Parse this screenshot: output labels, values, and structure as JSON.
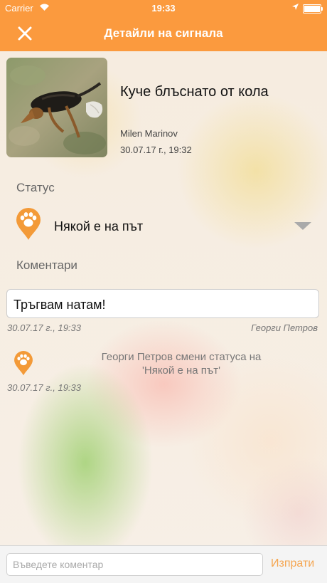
{
  "status_bar": {
    "carrier": "Carrier",
    "time": "19:33"
  },
  "nav": {
    "title": "Детайли на сигнала"
  },
  "report": {
    "title": "Куче блъснато от кола",
    "author": "Milen Marinov",
    "date": "30.07.17 г., 19:32"
  },
  "status_section": {
    "label": "Статус",
    "value": "Някой е на път"
  },
  "comments_section": {
    "label": "Коментари"
  },
  "comments": [
    {
      "text": "Тръгвам натам!",
      "date": "30.07.17 г., 19:33",
      "author": "Георги Петров"
    }
  ],
  "events": [
    {
      "line1": "Георги Петров смени статуса на",
      "line2": "'Някой е на път'",
      "date": "30.07.17 г., 19:33"
    }
  ],
  "compose": {
    "placeholder": "Въведете коментар",
    "send_label": "Изпрати"
  },
  "colors": {
    "accent": "#fb9a3e",
    "send": "#f5a651",
    "muted": "#777777"
  },
  "icons": {
    "close": "close-icon",
    "status_pin": "paw-pin-icon",
    "dropdown": "chevron-down-icon"
  }
}
